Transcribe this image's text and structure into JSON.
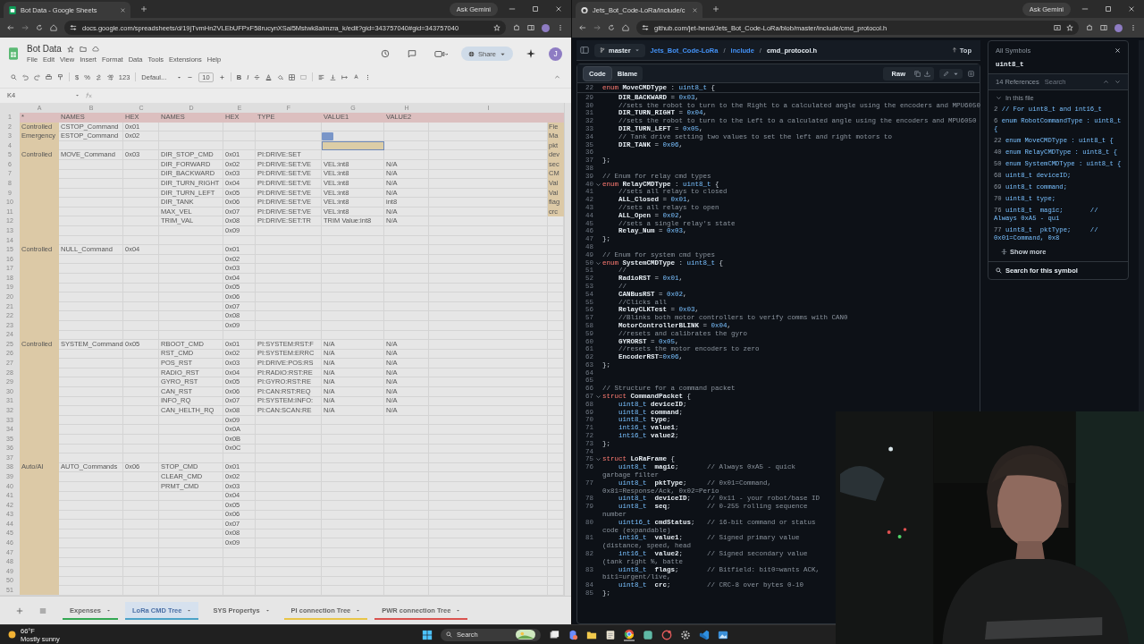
{
  "sheets_window": {
    "tab_title": "Bot Data - Google Sheets",
    "ask": "Ask Gemini",
    "url": "docs.google.com/spreadsheets/d/19jTvmHn2VLEbUFPxF58rucynXSal5Mstwk8almzra_k/edit?gid=343757040#gid=343757040",
    "doc": {
      "title": "Bot Data",
      "menu": [
        "File",
        "Edit",
        "View",
        "Insert",
        "Format",
        "Data",
        "Tools",
        "Extensions",
        "Help"
      ],
      "share": "Share",
      "avatar": "J"
    },
    "toolbar": {
      "currency": "$",
      "percent": "%",
      "number_format": "123",
      "font": "Defaul...",
      "font_size": "10",
      "bold": "B",
      "italic": "I"
    },
    "name_box": "K4",
    "columns": [
      "A",
      "B",
      "C",
      "D",
      "E",
      "F",
      "G",
      "H",
      "I"
    ],
    "rows": [
      {
        "n": "1",
        "selected": false,
        "a": "*",
        "b": "NAMES",
        "c": "HEX",
        "d": "NAMES",
        "e": "HEX",
        "f": "TYPE",
        "g": "VALUE1",
        "h": "VALUE2"
      },
      {
        "n": "2",
        "selected": false,
        "a": "Controlled",
        "b": "CSTOP_Command",
        "c": "0x01",
        "j": "Fie"
      },
      {
        "n": "3",
        "selected": false,
        "a": "Emergency",
        "b": "ESTOP_Command",
        "c": "0x02",
        "j": "Ma"
      },
      {
        "n": "4",
        "selected": true,
        "j": "pkt"
      },
      {
        "n": "5",
        "selected": false,
        "a": "Controlled",
        "b": "MOVE_Command",
        "c": "0x03",
        "d": "DIR_STOP_CMD",
        "e": "0x01",
        "f": "PI:DRIVE:SET",
        "j": "dev"
      },
      {
        "n": "6",
        "selected": false,
        "d": "DIR_FORWARD",
        "e": "0x02",
        "f": "PI:DRIVE:SET:VE",
        "g": "VEL:int8",
        "h": "N/A",
        "j": "sec"
      },
      {
        "n": "7",
        "selected": false,
        "d": "DIR_BACKWARD",
        "e": "0x03",
        "f": "PI:DRIVE:SET:VE",
        "g": "VEL:int8",
        "h": "N/A",
        "j": "CM"
      },
      {
        "n": "8",
        "selected": false,
        "d": "DIR_TURN_RIGHT",
        "e": "0x04",
        "f": "PI:DRIVE:SET:VE",
        "g": "VEL:int8",
        "h": "N/A",
        "j": "Val"
      },
      {
        "n": "9",
        "selected": false,
        "d": "DIR_TURN_LEFT",
        "e": "0x05",
        "f": "PI:DRIVE:SET:VE",
        "g": "VEL:int8",
        "h": "N/A",
        "j": "Val"
      },
      {
        "n": "10",
        "selected": false,
        "d": "DIR_TANK",
        "e": "0x06",
        "f": "PI:DRIVE:SET:VE",
        "g": "VEL:int8",
        "h": "int8",
        "j": "flag"
      },
      {
        "n": "11",
        "selected": false,
        "d": "MAX_VEL",
        "e": "0x07",
        "f": "PI:DRIVE:SET:VE",
        "g": "VEL:int8",
        "h": "N/A",
        "j": "crc"
      },
      {
        "n": "12",
        "selected": false,
        "d": "TRIM_VAL",
        "e": "0x08",
        "f": "PI:DRIVE:SET:TR",
        "g": "TRIM Value:int8",
        "h": "N/A"
      },
      {
        "n": "13",
        "selected": false,
        "e": "0x09"
      },
      {
        "n": "14",
        "selected": false
      },
      {
        "n": "15",
        "selected": false,
        "a": "Controlled",
        "b": "NULL_Command",
        "c": "0x04",
        "e": "0x01"
      },
      {
        "n": "16",
        "selected": false,
        "e": "0x02"
      },
      {
        "n": "17",
        "selected": false,
        "e": "0x03"
      },
      {
        "n": "18",
        "selected": false,
        "e": "0x04"
      },
      {
        "n": "19",
        "selected": false,
        "e": "0x05"
      },
      {
        "n": "20",
        "selected": false,
        "e": "0x06"
      },
      {
        "n": "21",
        "selected": false,
        "e": "0x07"
      },
      {
        "n": "22",
        "selected": false,
        "e": "0x08"
      },
      {
        "n": "23",
        "selected": false,
        "e": "0x09"
      },
      {
        "n": "24",
        "selected": false
      },
      {
        "n": "25",
        "selected": false,
        "a": "Controlled",
        "b": "SYSTEM_Command",
        "c": "0x05",
        "d": "RBOOT_CMD",
        "e": "0x01",
        "f": "PI:SYSTEM:RST:F",
        "g": "N/A",
        "h": "N/A"
      },
      {
        "n": "26",
        "selected": false,
        "d": "RST_CMD",
        "e": "0x02",
        "f": "PI:SYSTEM:ERRC",
        "g": "N/A",
        "h": "N/A"
      },
      {
        "n": "27",
        "selected": false,
        "d": "POS_RST",
        "e": "0x03",
        "f": "PI:DRIVE:POS:RS",
        "g": "N/A",
        "h": "N/A"
      },
      {
        "n": "28",
        "selected": false,
        "d": "RADIO_RST",
        "e": "0x04",
        "f": "PI:RADIO:RST:RE",
        "g": "N/A",
        "h": "N/A"
      },
      {
        "n": "29",
        "selected": false,
        "d": "GYRO_RST",
        "e": "0x05",
        "f": "PI:GYRO:RST:RE",
        "g": "N/A",
        "h": "N/A"
      },
      {
        "n": "30",
        "selected": false,
        "d": "CAN_RST",
        "e": "0x06",
        "f": "PI:CAN:RST:REQ",
        "g": "N/A",
        "h": "N/A"
      },
      {
        "n": "31",
        "selected": false,
        "d": "INFO_RQ",
        "e": "0x07",
        "f": "PI:SYSTEM:INFO:",
        "g": "N/A",
        "h": "N/A"
      },
      {
        "n": "32",
        "selected": false,
        "d": "CAN_HELTH_RQ",
        "e": "0x08",
        "f": "PI:CAN:SCAN:RE",
        "g": "N/A",
        "h": "N/A"
      },
      {
        "n": "33",
        "selected": false,
        "e": "0x09"
      },
      {
        "n": "34",
        "selected": false,
        "e": "0x0A"
      },
      {
        "n": "35",
        "selected": false,
        "e": "0x0B"
      },
      {
        "n": "36",
        "selected": false,
        "e": "0x0C"
      },
      {
        "n": "37",
        "selected": false
      },
      {
        "n": "38",
        "selected": false,
        "a": "Auto/AI",
        "b": "AUTO_Commands",
        "c": "0x06",
        "d": "STOP_CMD",
        "e": "0x01"
      },
      {
        "n": "39",
        "selected": false,
        "d": "CLEAR_CMD",
        "e": "0x02"
      },
      {
        "n": "40",
        "selected": false,
        "d": "PRMT_CMD",
        "e": "0x03"
      },
      {
        "n": "41",
        "selected": false,
        "e": "0x04"
      },
      {
        "n": "42",
        "selected": false,
        "e": "0x05"
      },
      {
        "n": "43",
        "selected": false,
        "e": "0x06"
      },
      {
        "n": "44",
        "selected": false,
        "e": "0x07"
      },
      {
        "n": "45",
        "selected": false,
        "e": "0x08"
      },
      {
        "n": "46",
        "selected": false,
        "e": "0x09"
      },
      {
        "n": "47",
        "selected": false
      },
      {
        "n": "48",
        "selected": false
      },
      {
        "n": "49",
        "selected": false
      },
      {
        "n": "50",
        "selected": false
      },
      {
        "n": "51",
        "selected": false
      }
    ],
    "sheet_tabs": [
      {
        "label": "Expenses",
        "selected": false,
        "color": "#34a853"
      },
      {
        "label": "LoRa CMD Tree",
        "selected": true,
        "color": "#4ba3c7"
      },
      {
        "label": "SYS Propertys",
        "selected": false
      },
      {
        "label": "PI connection Tree",
        "selected": false,
        "color": "#e8c547"
      },
      {
        "label": "PWR connection Tree",
        "selected": false,
        "color": "#d9534f"
      }
    ]
  },
  "github_window": {
    "tab_title": "Jets_Bot_Code-LoRa/include/c",
    "ask": "Ask Gemini",
    "url": "github.com/jet-hend/Jets_Bot_Code-LoRa/blob/master/include/cmd_protocol.h",
    "branch": "master",
    "path": [
      {
        "label": "Jets_Bot_Code-LoRa",
        "kind": "link"
      },
      {
        "label": "/",
        "kind": "separator"
      },
      {
        "label": "include",
        "kind": "link"
      },
      {
        "label": "/",
        "kind": "separator"
      },
      {
        "label": "cmd_protocol.h",
        "kind": "file"
      }
    ],
    "top": "Top",
    "view_tabs": [
      {
        "label": "Code",
        "selected": true
      },
      {
        "label": "Blame",
        "selected": false
      }
    ],
    "raw": "Raw",
    "sticky": {
      "n": "22",
      "s": [
        {
          "kind": "keyword",
          "text": "enum "
        },
        {
          "kind": "name",
          "text": "MoveCMDType"
        },
        {
          "kind": "plain",
          "text": " : "
        },
        {
          "kind": "type",
          "text": "uint8_t"
        },
        {
          "kind": "plain",
          "text": " {"
        }
      ]
    },
    "lines": [
      {
        "n": "29",
        "s": [
          {
            "kind": "name",
            "text": "    DIR_BACKWARD"
          },
          {
            "kind": "plain",
            "text": " = "
          },
          {
            "kind": "number",
            "text": "0x03"
          },
          {
            "kind": "plain",
            "text": ","
          }
        ]
      },
      {
        "n": "30",
        "s": [
          {
            "kind": "comment",
            "text": "    //sets the robot to turn to the Right to a calculated angle using the encoders and MPU6050"
          }
        ]
      },
      {
        "n": "31",
        "s": [
          {
            "kind": "name",
            "text": "    DIR_TURN_RIGHT"
          },
          {
            "kind": "plain",
            "text": " = "
          },
          {
            "kind": "number",
            "text": "0x04"
          },
          {
            "kind": "plain",
            "text": ","
          }
        ]
      },
      {
        "n": "32",
        "s": [
          {
            "kind": "comment",
            "text": "    //sets the robot to turn to the Left to a calculated angle using the encoders and MPU6050"
          }
        ]
      },
      {
        "n": "33",
        "s": [
          {
            "kind": "name",
            "text": "    DIR_TURN_LEFT"
          },
          {
            "kind": "plain",
            "text": " = "
          },
          {
            "kind": "number",
            "text": "0x05"
          },
          {
            "kind": "plain",
            "text": ","
          }
        ]
      },
      {
        "n": "34",
        "s": [
          {
            "kind": "comment",
            "text": "    // Tank drive setting two values to set the left and right motors to"
          }
        ]
      },
      {
        "n": "35",
        "s": [
          {
            "kind": "name",
            "text": "    DIR_TANK"
          },
          {
            "kind": "plain",
            "text": " = "
          },
          {
            "kind": "number",
            "text": "0x06"
          },
          {
            "kind": "plain",
            "text": ","
          }
        ]
      },
      {
        "n": "36"
      },
      {
        "n": "37",
        "s": [
          {
            "kind": "plain",
            "text": "};"
          }
        ]
      },
      {
        "n": "38"
      },
      {
        "n": "39",
        "s": [
          {
            "kind": "comment",
            "text": "// Enum for relay cmd types"
          }
        ]
      },
      {
        "n": "40",
        "expanded": true,
        "s": [
          {
            "kind": "keyword",
            "text": "enum "
          },
          {
            "kind": "name",
            "text": "RelayCMDType"
          },
          {
            "kind": "plain",
            "text": " : "
          },
          {
            "kind": "type",
            "text": "uint8_t"
          },
          {
            "kind": "plain",
            "text": " {"
          }
        ]
      },
      {
        "n": "41",
        "s": [
          {
            "kind": "comment",
            "text": "    //sets all relays to closed"
          }
        ]
      },
      {
        "n": "42",
        "s": [
          {
            "kind": "name",
            "text": "    ALL_Closed"
          },
          {
            "kind": "plain",
            "text": " = "
          },
          {
            "kind": "number",
            "text": "0x01"
          },
          {
            "kind": "plain",
            "text": ","
          }
        ]
      },
      {
        "n": "43",
        "s": [
          {
            "kind": "comment",
            "text": "    //sets all relays to open"
          }
        ]
      },
      {
        "n": "44",
        "s": [
          {
            "kind": "name",
            "text": "    ALL_Open"
          },
          {
            "kind": "plain",
            "text": " = "
          },
          {
            "kind": "number",
            "text": "0x02"
          },
          {
            "kind": "plain",
            "text": ","
          }
        ]
      },
      {
        "n": "45",
        "s": [
          {
            "kind": "comment",
            "text": "    //sets a single relay's state"
          }
        ]
      },
      {
        "n": "46",
        "s": [
          {
            "kind": "name",
            "text": "    Relay_Num"
          },
          {
            "kind": "plain",
            "text": " = "
          },
          {
            "kind": "number",
            "text": "0x03"
          },
          {
            "kind": "plain",
            "text": ","
          }
        ]
      },
      {
        "n": "47",
        "s": [
          {
            "kind": "plain",
            "text": "};"
          }
        ]
      },
      {
        "n": "48"
      },
      {
        "n": "49",
        "s": [
          {
            "kind": "comment",
            "text": "// Enum for system cmd types"
          }
        ]
      },
      {
        "n": "50",
        "expanded": true,
        "s": [
          {
            "kind": "keyword",
            "text": "enum "
          },
          {
            "kind": "name",
            "text": "SystemCMDType"
          },
          {
            "kind": "plain",
            "text": " : "
          },
          {
            "kind": "type",
            "text": "uint8_t"
          },
          {
            "kind": "plain",
            "text": " {"
          }
        ]
      },
      {
        "n": "51",
        "s": [
          {
            "kind": "comment",
            "text": "    //"
          }
        ]
      },
      {
        "n": "52",
        "s": [
          {
            "kind": "name",
            "text": "    RadioRST"
          },
          {
            "kind": "plain",
            "text": " = "
          },
          {
            "kind": "number",
            "text": "0x01"
          },
          {
            "kind": "plain",
            "text": ","
          }
        ]
      },
      {
        "n": "53",
        "s": [
          {
            "kind": "comment",
            "text": "    //"
          }
        ]
      },
      {
        "n": "54",
        "s": [
          {
            "kind": "name",
            "text": "    CANBusRST"
          },
          {
            "kind": "plain",
            "text": " = "
          },
          {
            "kind": "number",
            "text": "0x02"
          },
          {
            "kind": "plain",
            "text": ","
          }
        ]
      },
      {
        "n": "55",
        "s": [
          {
            "kind": "comment",
            "text": "    //Clicks all"
          }
        ]
      },
      {
        "n": "56",
        "s": [
          {
            "kind": "name",
            "text": "    RelayCLKTest"
          },
          {
            "kind": "plain",
            "text": " = "
          },
          {
            "kind": "number",
            "text": "0x03"
          },
          {
            "kind": "plain",
            "text": ","
          }
        ]
      },
      {
        "n": "57",
        "s": [
          {
            "kind": "comment",
            "text": "    //Blinks both motor controllers to verify comms with CAN0"
          }
        ]
      },
      {
        "n": "58",
        "s": [
          {
            "kind": "name",
            "text": "    MotorControllerBLINK"
          },
          {
            "kind": "plain",
            "text": " = "
          },
          {
            "kind": "number",
            "text": "0x04"
          },
          {
            "kind": "plain",
            "text": ","
          }
        ]
      },
      {
        "n": "59",
        "s": [
          {
            "kind": "comment",
            "text": "    //resets and calibrates the gyro"
          }
        ]
      },
      {
        "n": "60",
        "s": [
          {
            "kind": "name",
            "text": "    GYRORST"
          },
          {
            "kind": "plain",
            "text": " = "
          },
          {
            "kind": "number",
            "text": "0x05"
          },
          {
            "kind": "plain",
            "text": ","
          }
        ]
      },
      {
        "n": "61",
        "s": [
          {
            "kind": "comment",
            "text": "    //resets the motor encoders to zero"
          }
        ]
      },
      {
        "n": "62",
        "s": [
          {
            "kind": "name",
            "text": "    EncoderRST"
          },
          {
            "kind": "plain",
            "text": "="
          },
          {
            "kind": "number",
            "text": "0x06"
          },
          {
            "kind": "plain",
            "text": ","
          }
        ]
      },
      {
        "n": "63",
        "s": [
          {
            "kind": "plain",
            "text": "};"
          }
        ]
      },
      {
        "n": "64"
      },
      {
        "n": "65"
      },
      {
        "n": "66",
        "s": [
          {
            "kind": "comment",
            "text": "// Structure for a command packet"
          }
        ]
      },
      {
        "n": "67",
        "expanded": true,
        "s": [
          {
            "kind": "keyword",
            "text": "struct "
          },
          {
            "kind": "name",
            "text": "CommandPacket"
          },
          {
            "kind": "plain",
            "text": " {"
          }
        ]
      },
      {
        "n": "68",
        "s": [
          {
            "kind": "type",
            "text": "    uint8_t"
          },
          {
            "kind": "name",
            "text": " deviceID"
          },
          {
            "kind": "plain",
            "text": ";"
          }
        ]
      },
      {
        "n": "69",
        "s": [
          {
            "kind": "type",
            "text": "    uint8_t"
          },
          {
            "kind": "name",
            "text": " command"
          },
          {
            "kind": "plain",
            "text": ";"
          }
        ]
      },
      {
        "n": "70",
        "s": [
          {
            "kind": "type",
            "text": "    uint8_t"
          },
          {
            "kind": "name",
            "text": " type"
          },
          {
            "kind": "plain",
            "text": ";"
          }
        ]
      },
      {
        "n": "71",
        "s": [
          {
            "kind": "type",
            "text": "    int16_t"
          },
          {
            "kind": "name",
            "text": " value1"
          },
          {
            "kind": "plain",
            "text": ";"
          }
        ]
      },
      {
        "n": "72",
        "s": [
          {
            "kind": "type",
            "text": "    int16_t"
          },
          {
            "kind": "name",
            "text": " value2"
          },
          {
            "kind": "plain",
            "text": ";"
          }
        ]
      },
      {
        "n": "73",
        "s": [
          {
            "kind": "plain",
            "text": "};"
          }
        ]
      },
      {
        "n": "74"
      },
      {
        "n": "75",
        "expanded": true,
        "s": [
          {
            "kind": "keyword",
            "text": "struct "
          },
          {
            "kind": "name",
            "text": "LoRaFrame"
          },
          {
            "kind": "plain",
            "text": " {"
          }
        ]
      },
      {
        "n": "76",
        "s": [
          {
            "kind": "type",
            "text": "    uint8_t"
          },
          {
            "kind": "name",
            "text": "  magic"
          },
          {
            "kind": "plain",
            "text": ";       "
          },
          {
            "kind": "comment",
            "text": "// Always 0xA5 - quick garbage filter"
          }
        ]
      },
      {
        "n": "77",
        "s": [
          {
            "kind": "type",
            "text": "    uint8_t"
          },
          {
            "kind": "name",
            "text": "  pktType"
          },
          {
            "kind": "plain",
            "text": ";     "
          },
          {
            "kind": "comment",
            "text": "// 0x01=Command, 0x81=Response/Ack, 0x02=Perio"
          }
        ]
      },
      {
        "n": "78",
        "s": [
          {
            "kind": "type",
            "text": "    uint8_t"
          },
          {
            "kind": "name",
            "text": "  deviceID"
          },
          {
            "kind": "plain",
            "text": ";    "
          },
          {
            "kind": "comment",
            "text": "// 0x11 - your robot/base ID"
          }
        ]
      },
      {
        "n": "79",
        "s": [
          {
            "kind": "type",
            "text": "    uint8_t"
          },
          {
            "kind": "name",
            "text": "  seq"
          },
          {
            "kind": "plain",
            "text": ";         "
          },
          {
            "kind": "comment",
            "text": "// 0-255 rolling sequence number"
          }
        ]
      },
      {
        "n": "80",
        "s": [
          {
            "kind": "type",
            "text": "    uint16_t"
          },
          {
            "kind": "name",
            "text": " cmdStatus"
          },
          {
            "kind": "plain",
            "text": ";   "
          },
          {
            "kind": "comment",
            "text": "// 16-bit command or status code (expandable)"
          }
        ]
      },
      {
        "n": "81",
        "s": [
          {
            "kind": "type",
            "text": "    int16_t"
          },
          {
            "kind": "name",
            "text": "  value1"
          },
          {
            "kind": "plain",
            "text": ";      "
          },
          {
            "kind": "comment",
            "text": "// Signed primary value (distance, speed, head"
          }
        ]
      },
      {
        "n": "82",
        "s": [
          {
            "kind": "type",
            "text": "    int16_t"
          },
          {
            "kind": "name",
            "text": "  value2"
          },
          {
            "kind": "plain",
            "text": ";      "
          },
          {
            "kind": "comment",
            "text": "// Signed secondary value (tank right %, batte"
          }
        ]
      },
      {
        "n": "83",
        "s": [
          {
            "kind": "type",
            "text": "    uint8_t"
          },
          {
            "kind": "name",
            "text": "  flags"
          },
          {
            "kind": "plain",
            "text": ";       "
          },
          {
            "kind": "comment",
            "text": "// Bitfield: bit0=wants ACK, bit1=urgent/live,"
          }
        ]
      },
      {
        "n": "84",
        "s": [
          {
            "kind": "type",
            "text": "    uint8_t"
          },
          {
            "kind": "name",
            "text": "  crc"
          },
          {
            "kind": "plain",
            "text": ";         "
          },
          {
            "kind": "comment",
            "text": "// CRC-8 over bytes 0-10"
          }
        ]
      },
      {
        "n": "85",
        "s": [
          {
            "kind": "plain",
            "text": "};"
          }
        ]
      }
    ],
    "symbols": {
      "back": "All Symbols",
      "symbol": "uint8_t",
      "references": "14 References",
      "search": "Search",
      "group": "In this file",
      "items": [
        {
          "n": "2",
          "text": "// For uint8_t and int16_t"
        },
        {
          "n": "6",
          "text": "enum RobotCommandType : uint8_t {"
        },
        {
          "n": "22",
          "text": "enum MoveCMDType : uint8_t {"
        },
        {
          "n": "40",
          "text": "enum RelayCMDType : uint8_t {"
        },
        {
          "n": "50",
          "text": "enum SystemCMDType : uint8_t {"
        },
        {
          "n": "68",
          "text": "uint8_t deviceID;"
        },
        {
          "n": "69",
          "text": "uint8_t command;"
        },
        {
          "n": "70",
          "text": "uint8_t type;"
        },
        {
          "n": "76",
          "text": "uint8_t  magic;       // Always 0xA5 - qui"
        },
        {
          "n": "77",
          "text": "uint8_t  pktType;     // 0x01=Command, 0x8"
        }
      ],
      "show_more": "Show more",
      "search_symbol": "Search for this symbol"
    }
  },
  "taskbar": {
    "temperature": "66°F",
    "weather": "Mostly sunny",
    "search": "Search"
  }
}
